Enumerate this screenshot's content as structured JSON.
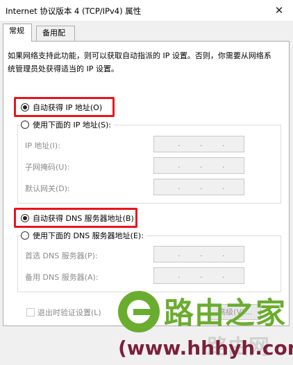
{
  "window": {
    "title": "Internet 协议版本 4 (TCP/IPv4) 属性",
    "close_glyph": "✕"
  },
  "tabs": [
    {
      "label": "常规",
      "active": true
    },
    {
      "label": "备用配置",
      "active": false
    }
  ],
  "description": "如果网络支持此功能，则可以获取自动指派的 IP 设置。否则，你需要从网络系统管理员处获得适当的 IP 设置。",
  "ip_section": {
    "auto_label": "自动获得 IP 地址(O)",
    "auto_selected": true,
    "manual_label": "使用下面的 IP 地址(S):",
    "manual_selected": false,
    "fields": [
      {
        "label": "IP 地址(I):",
        "value": "   .   .   ."
      },
      {
        "label": "子网掩码(U):",
        "value": "   .   .   ."
      },
      {
        "label": "默认网关(D):",
        "value": "   .   .   ."
      }
    ]
  },
  "dns_section": {
    "auto_label": "自动获得 DNS 服务器地址(B)",
    "auto_selected": true,
    "manual_label": "使用下面的 DNS 服务器地址(E):",
    "manual_selected": false,
    "fields": [
      {
        "label": "首选 DNS 服务器(P):",
        "value": "   .   .   ."
      },
      {
        "label": "备用 DNS 服务器(A):",
        "value": "   .   .   ."
      }
    ]
  },
  "validate_on_exit": {
    "label": "退出时验证设置(L)",
    "checked": false
  },
  "advanced_button": {
    "label": "高级(V)..."
  },
  "watermark": {
    "brand": "路由之家",
    "ghost_text": "路由网",
    "url": "(www.hhhyh.com"
  },
  "colors": {
    "highlight": "#e8141e",
    "watermark_green": "#6aad2e",
    "watermark_url": "#7b1f3a"
  }
}
